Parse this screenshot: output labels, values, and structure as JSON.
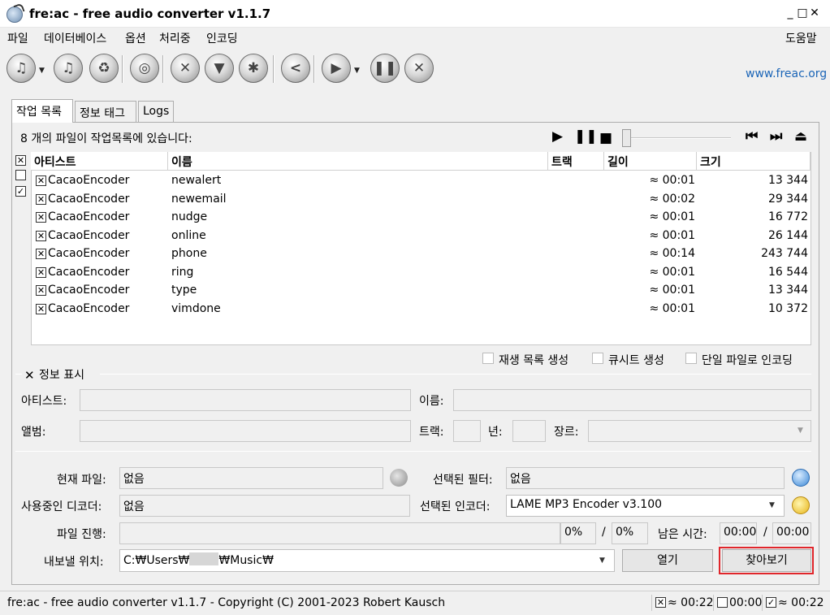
{
  "window": {
    "title": "fre:ac - free audio converter v1.1.7",
    "minimize": "_",
    "maximize": "□",
    "close": "✕"
  },
  "menu": {
    "file": "파일",
    "database": "데이터베이스",
    "options": "옵션",
    "processing": "처리중",
    "encoding": "인코딩",
    "help": "도움말"
  },
  "toolbar": {
    "website": "www.freac.org",
    "icons": [
      "add-files-icon",
      "add-cd-icon",
      "remove-icon",
      "query-cddb-icon",
      "configure-icon",
      "filter-icon",
      "settings-icon",
      "share-icon",
      "start-encoding-icon",
      "pause-icon",
      "stop-icon"
    ]
  },
  "tabs": [
    "작업 목록",
    "정보 태그",
    "Logs"
  ],
  "joblist": {
    "status": "8 개의 파일이 작업목록에 있습니다:",
    "columns": {
      "artist": "아티스트",
      "title": "이름",
      "track": "트랙",
      "length": "길이",
      "size": "크기"
    },
    "rows": [
      {
        "artist": "CacaoEncoder",
        "title": "newalert",
        "length": "≈ 00:01",
        "size": "13 344"
      },
      {
        "artist": "CacaoEncoder",
        "title": "newemail",
        "length": "≈ 00:02",
        "size": "29 344"
      },
      {
        "artist": "CacaoEncoder",
        "title": "nudge",
        "length": "≈ 00:01",
        "size": "16 772"
      },
      {
        "artist": "CacaoEncoder",
        "title": "online",
        "length": "≈ 00:01",
        "size": "26 144"
      },
      {
        "artist": "CacaoEncoder",
        "title": "phone",
        "length": "≈ 00:14",
        "size": "243 744"
      },
      {
        "artist": "CacaoEncoder",
        "title": "ring",
        "length": "≈ 00:01",
        "size": "16 544"
      },
      {
        "artist": "CacaoEncoder",
        "title": "type",
        "length": "≈ 00:01",
        "size": "13 344"
      },
      {
        "artist": "CacaoEncoder",
        "title": "vimdone",
        "length": "≈ 00:01",
        "size": "10 372"
      }
    ]
  },
  "options": {
    "playlist": "재생 목록 생성",
    "cuesheet": "큐시트 생성",
    "single_file": "단일 파일로 인코딩"
  },
  "info": {
    "show": "정보 표시",
    "artist": "아티스트:",
    "title": "이름:",
    "album": "앨범:",
    "track": "트랙:",
    "year": "년:",
    "genre": "장르:"
  },
  "progress": {
    "current_file_label": "현재 파일:",
    "current_file": "없음",
    "filter_label": "선택된 필터:",
    "filter": "없음",
    "decoder_label": "사용중인 디코더:",
    "decoder": "없음",
    "encoder_label": "선택된 인코더:",
    "encoder": "LAME MP3 Encoder v3.100",
    "file_progress_label": "파일 진행:",
    "file_percent": "0%",
    "slash": "/",
    "total_percent": "0%",
    "time_left_label": "남은 시간:",
    "time_left": "00:00",
    "total_time": "00:00",
    "output_label": "내보낼 위치:",
    "output_path_start": "C:₩Users₩",
    "output_path_end": "₩Music₩",
    "open_button": "열기",
    "browse_button": "찾아보기"
  },
  "statusbar": {
    "text": "fre:ac - free audio converter v1.1.7 - Copyright (C) 2001-2023 Robert Kausch",
    "selected_time": "≈ 00:22",
    "unselected_time": "00:00",
    "total_time": "≈ 00:22"
  },
  "colors": {
    "link": "#1b65b7",
    "highlight_border": "#e0262b"
  }
}
